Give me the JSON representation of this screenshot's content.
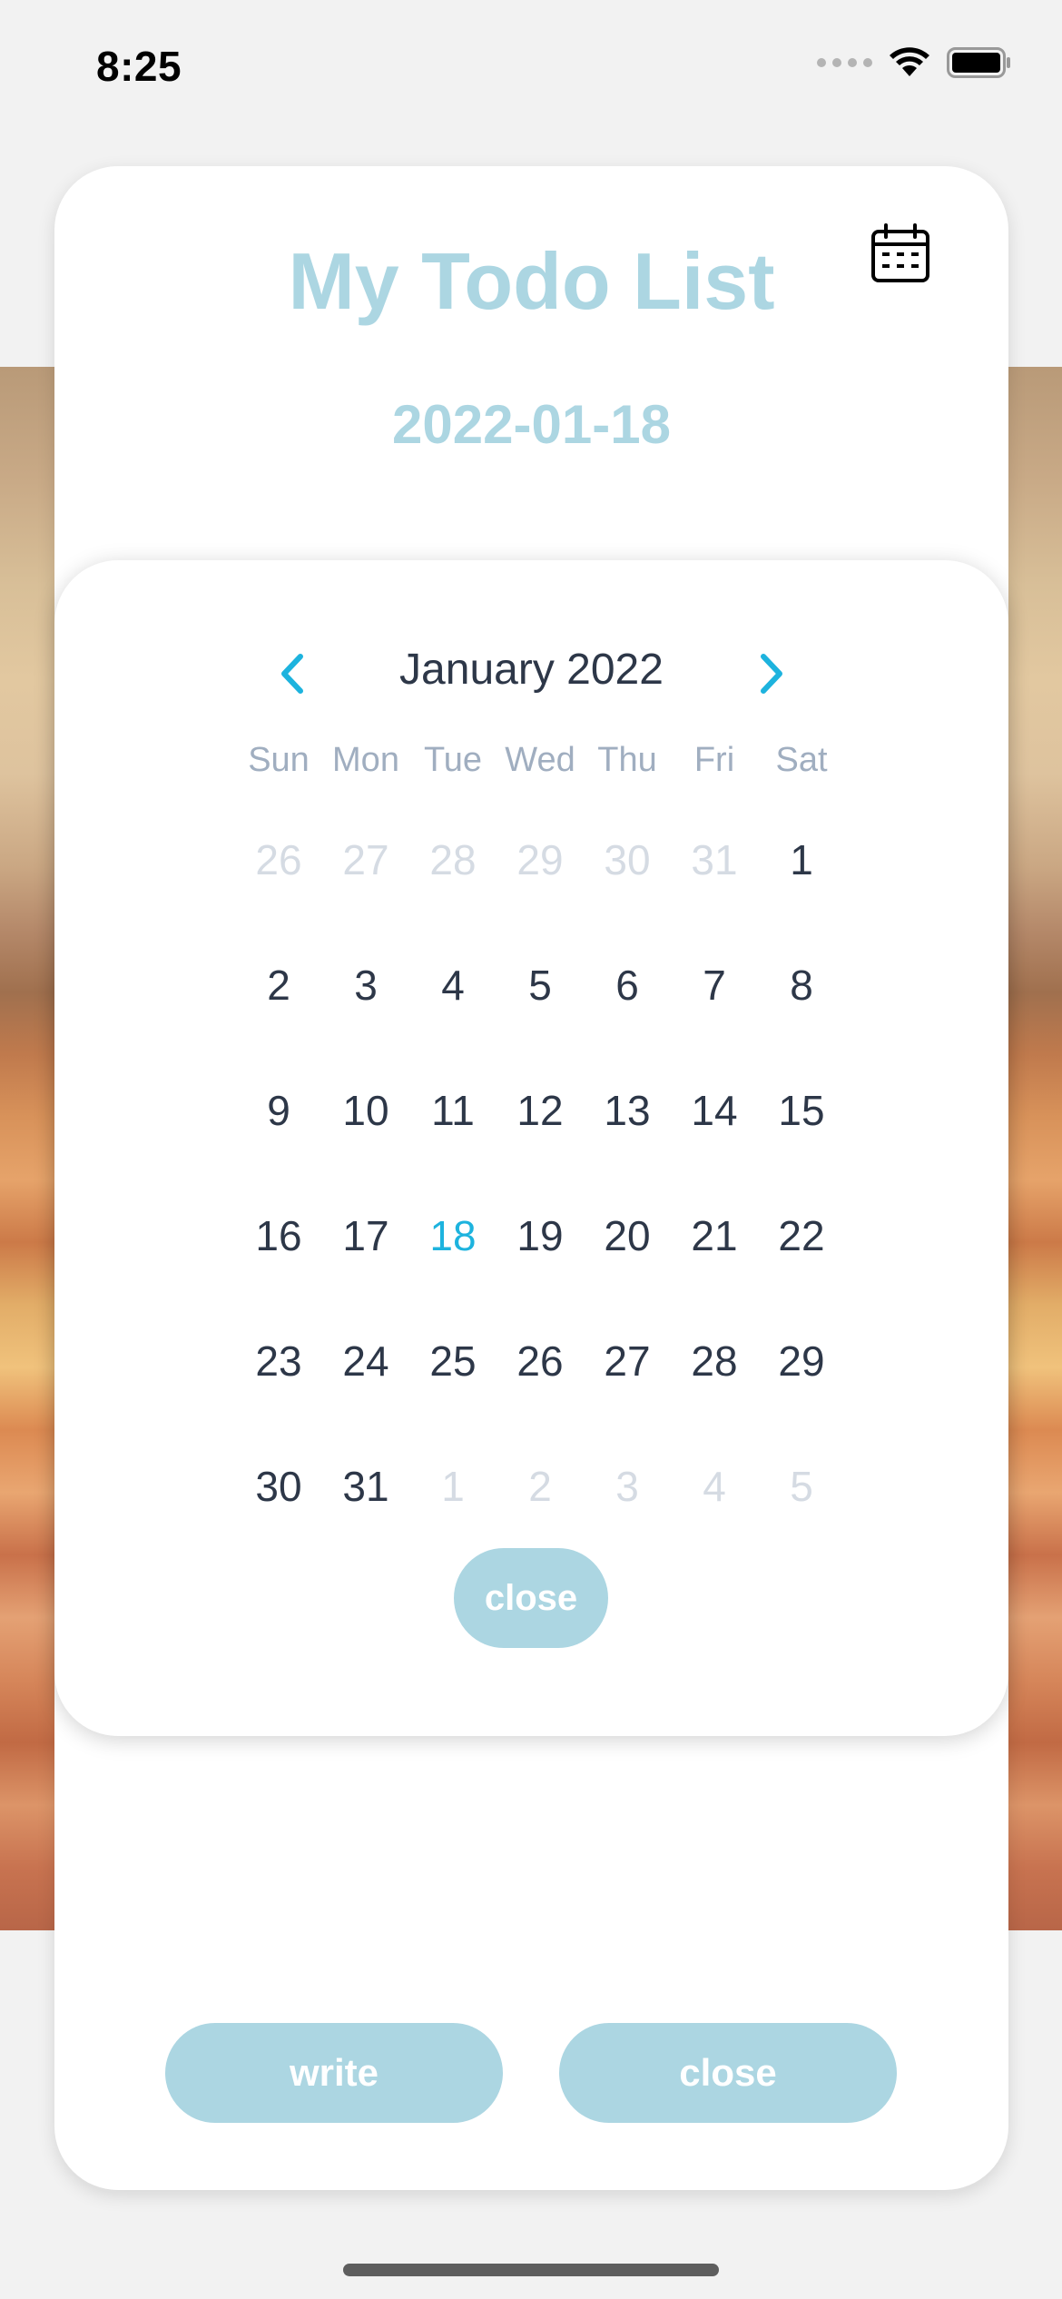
{
  "status_bar": {
    "time": "8:25"
  },
  "header": {
    "title": "My Todo List",
    "selected_date": "2022-01-18",
    "calendar_icon": "calendar-icon"
  },
  "calendar": {
    "month_label": "January 2022",
    "prev_icon": "chevron-left-icon",
    "next_icon": "chevron-right-icon",
    "weekdays": [
      "Sun",
      "Mon",
      "Tue",
      "Wed",
      "Thu",
      "Fri",
      "Sat"
    ],
    "weeks": [
      [
        "26",
        "27",
        "28",
        "29",
        "30",
        "31",
        "1"
      ],
      [
        "2",
        "3",
        "4",
        "5",
        "6",
        "7",
        "8"
      ],
      [
        "9",
        "10",
        "11",
        "12",
        "13",
        "14",
        "15"
      ],
      [
        "16",
        "17",
        "18",
        "19",
        "20",
        "21",
        "22"
      ],
      [
        "23",
        "24",
        "25",
        "26",
        "27",
        "28",
        "29"
      ],
      [
        "30",
        "31",
        "1",
        "2",
        "3",
        "4",
        "5"
      ]
    ],
    "selected_day": "18",
    "close_label": "close"
  },
  "footer": {
    "write_label": "write",
    "close_label": "close"
  },
  "colors": {
    "accent": "#acd6e2",
    "selected_day": "#1db3de",
    "nav_arrow": "#1db3de",
    "text_dark": "#2d3748",
    "text_muted": "#d5dbe3"
  }
}
